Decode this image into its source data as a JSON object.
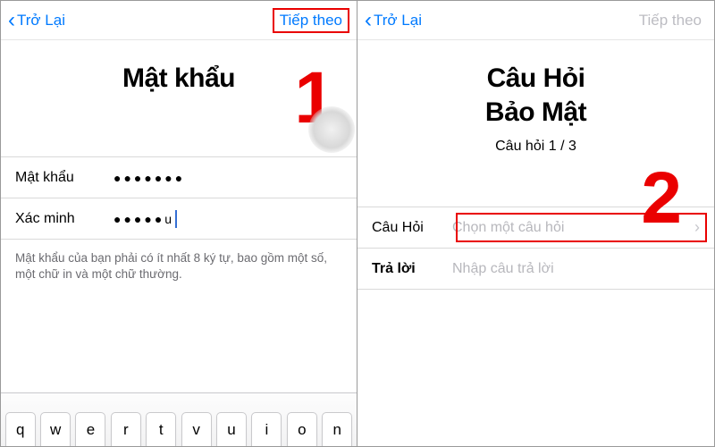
{
  "colors": {
    "accent": "#007aff",
    "highlight": "#e90000",
    "placeholder": "#b7b7bc"
  },
  "left": {
    "nav": {
      "back": "Trở Lại",
      "next": "Tiếp theo"
    },
    "title": "Mật khẩu",
    "badge": "1",
    "fields": {
      "password": {
        "label": "Mật khẩu",
        "value": "●●●●●●●"
      },
      "verify": {
        "label": "Xác minh",
        "value": "●●●●●u"
      }
    },
    "hint": "Mật khẩu của bạn phải có ít nhất 8 ký tự, bao gồm một số, một chữ in và một chữ thường.",
    "keyboard": [
      "q",
      "w",
      "e",
      "r",
      "t",
      "v",
      "u",
      "i",
      "o",
      "n"
    ]
  },
  "right": {
    "nav": {
      "back": "Trở Lại",
      "next": "Tiếp theo"
    },
    "title_line1": "Câu Hỏi",
    "title_line2": "Bảo Mật",
    "subtitle": "Câu hỏi 1 / 3",
    "badge": "2",
    "question": {
      "label": "Câu Hỏi",
      "placeholder": "Chọn một câu hỏi"
    },
    "answer": {
      "label": "Trả lời",
      "placeholder": "Nhập câu trả lời"
    }
  }
}
